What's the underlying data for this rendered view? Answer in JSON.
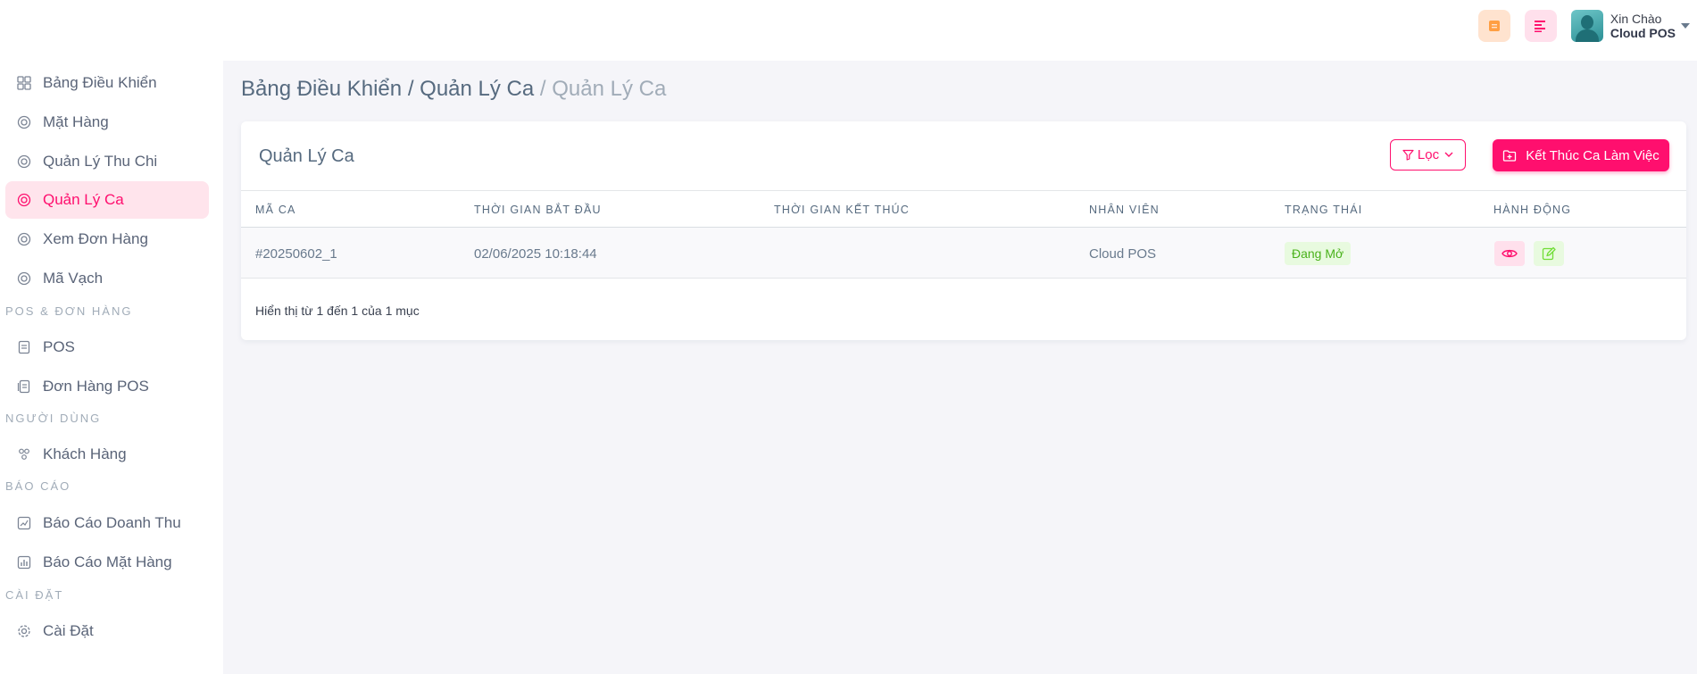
{
  "header": {
    "greeting": "Xin Chào",
    "user_name": "Cloud POS",
    "colors": {
      "accent": "#ff0f6e",
      "notify_bg": "#ffe3cf",
      "notify_icon": "#ff9f43"
    }
  },
  "sidebar": {
    "items_top": [
      {
        "label": "Bảng Điều Khiển",
        "icon": "dashboard-icon"
      },
      {
        "label": "Mặt Hàng",
        "icon": "circle-icon"
      },
      {
        "label": "Quản Lý Thu Chi",
        "icon": "circle-icon"
      },
      {
        "label": "Quản Lý Ca",
        "icon": "circle-icon",
        "active": true
      },
      {
        "label": "Xem Đơn Hàng",
        "icon": "circle-icon"
      },
      {
        "label": "Mã Vạch",
        "icon": "circle-icon"
      }
    ],
    "section_pos": "POS & ĐƠN HÀNG",
    "items_pos": [
      {
        "label": "POS",
        "icon": "receipt-icon"
      },
      {
        "label": "Đơn Hàng POS",
        "icon": "receipt-list-icon"
      }
    ],
    "section_users": "NGƯỜI DÙNG",
    "items_users": [
      {
        "label": "Khách Hàng",
        "icon": "users-icon"
      }
    ],
    "section_reports": "BÁO CÁO",
    "items_reports": [
      {
        "label": "Báo Cáo Doanh Thu",
        "icon": "chart-line-icon"
      },
      {
        "label": "Báo Cáo Mặt Hàng",
        "icon": "chart-bar-icon"
      }
    ],
    "section_settings": "CÀI ĐẶT",
    "items_settings": [
      {
        "label": "Cài Đặt",
        "icon": "gear-icon"
      }
    ]
  },
  "breadcrumb": {
    "level1": "Bảng Điều Khiển",
    "level2": "Quản Lý Ca",
    "current": "Quản Lý Ca",
    "separator": "/"
  },
  "card": {
    "title": "Quản Lý Ca",
    "filter_label": "Lọc",
    "end_shift_label": "Kết Thúc Ca Làm Việc"
  },
  "table": {
    "columns": [
      "MÃ CA",
      "THỜI GIAN BẮT ĐẦU",
      "THỜI GIAN KẾT THÚC",
      "NHÂN VIÊN",
      "TRẠNG THÁI",
      "HÀNH ĐỘNG"
    ],
    "rows": [
      {
        "code": "#20250602_1",
        "start": "02/06/2025 10:18:44",
        "end": "",
        "staff": "Cloud POS",
        "status": "Đang Mở"
      }
    ],
    "pagination_info": "Hiển thị từ 1 đến 1 của 1 mục"
  }
}
